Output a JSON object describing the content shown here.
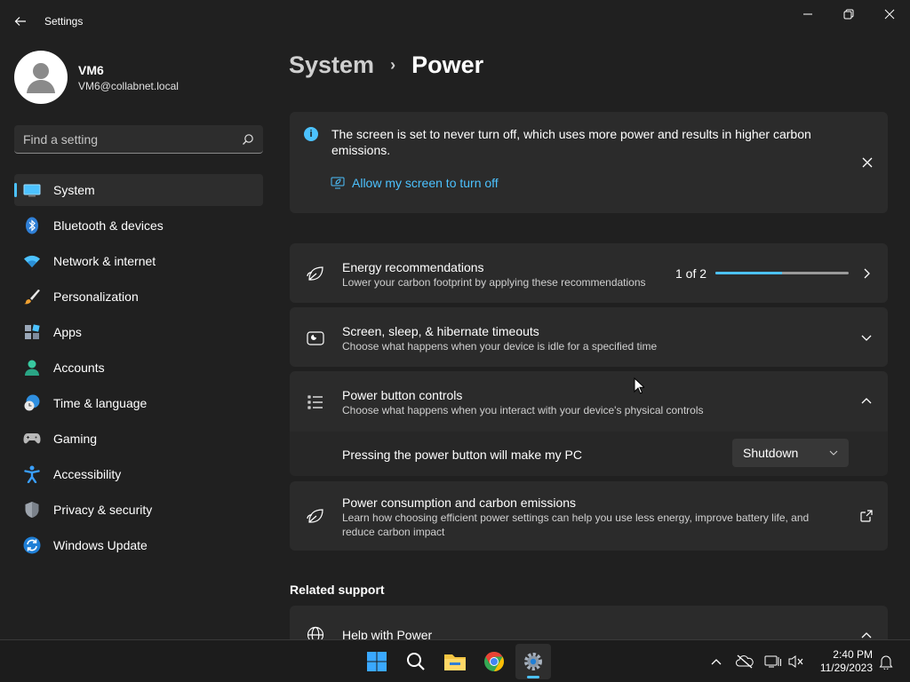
{
  "window": {
    "title": "Settings"
  },
  "profile": {
    "name": "VM6",
    "email": "VM6@collabnet.local"
  },
  "search": {
    "placeholder": "Find a setting"
  },
  "sidebar": {
    "items": [
      {
        "label": "System",
        "icon": "system-icon",
        "active": true
      },
      {
        "label": "Bluetooth & devices",
        "icon": "bluetooth-icon"
      },
      {
        "label": "Network & internet",
        "icon": "wifi-icon"
      },
      {
        "label": "Personalization",
        "icon": "brush-icon"
      },
      {
        "label": "Apps",
        "icon": "apps-icon"
      },
      {
        "label": "Accounts",
        "icon": "accounts-icon"
      },
      {
        "label": "Time & language",
        "icon": "clock-globe-icon"
      },
      {
        "label": "Gaming",
        "icon": "gamepad-icon"
      },
      {
        "label": "Accessibility",
        "icon": "accessibility-icon"
      },
      {
        "label": "Privacy & security",
        "icon": "shield-icon"
      },
      {
        "label": "Windows Update",
        "icon": "update-icon"
      }
    ]
  },
  "breadcrumb": {
    "parent": "System",
    "separator": "›",
    "current": "Power"
  },
  "info": {
    "text": "The screen is set to never turn off, which uses more power and results in higher carbon emissions.",
    "link": "Allow my screen to turn off",
    "info_glyph": "i"
  },
  "cards": {
    "energy": {
      "title": "Energy recommendations",
      "subtitle": "Lower your carbon footprint by applying these recommendations",
      "pager": "1 of 2",
      "progress": 0.5
    },
    "screen_sleep": {
      "title": "Screen, sleep, & hibernate timeouts",
      "subtitle": "Choose what happens when your device is idle for a specified time"
    },
    "power_button": {
      "title": "Power button controls",
      "subtitle": "Choose what happens when you interact with your device's physical controls",
      "setting_label": "Pressing the power button will make my PC",
      "setting_value": "Shutdown"
    },
    "consumption": {
      "title": "Power consumption and carbon emissions",
      "subtitle": "Learn how choosing efficient power settings can help you use less energy, improve battery life, and reduce carbon impact"
    }
  },
  "related": {
    "heading": "Related support",
    "help_title": "Help with Power"
  },
  "taskbar": {
    "time": "2:40 PM",
    "date": "11/29/2023",
    "apps": [
      "windows-start-icon",
      "search-icon",
      "file-explorer-icon",
      "chrome-icon",
      "settings-icon"
    ]
  },
  "colors": {
    "accent": "#4cc2ff",
    "background": "#202020",
    "card": "#2b2b2b"
  }
}
